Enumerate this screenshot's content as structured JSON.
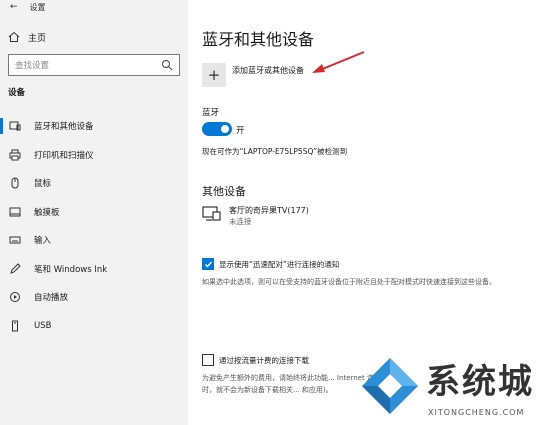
{
  "window": {
    "title": "设置"
  },
  "sidebar": {
    "home_label": "主页",
    "search_placeholder": "查找设置",
    "section_label": "设备",
    "items": [
      {
        "label": "蓝牙和其他设备",
        "icon": "bluetooth-icon",
        "active": true
      },
      {
        "label": "打印机和扫描仪",
        "icon": "printer-icon"
      },
      {
        "label": "鼠标",
        "icon": "mouse-icon"
      },
      {
        "label": "触摸板",
        "icon": "touchpad-icon"
      },
      {
        "label": "输入",
        "icon": "keyboard-icon"
      },
      {
        "label": "笔和 Windows Ink",
        "icon": "pen-icon"
      },
      {
        "label": "自动播放",
        "icon": "autoplay-icon"
      },
      {
        "label": "USB",
        "icon": "usb-icon"
      }
    ]
  },
  "main": {
    "title": "蓝牙和其他设备",
    "add_label": "添加蓝牙或其他设备",
    "bluetooth_label": "蓝牙",
    "toggle_state": "开",
    "discover_text": "现在可作为“LAPTOP-E75LP5SQ”被检测到",
    "other_devices_title": "其他设备",
    "device": {
      "name": "客厅的奇异果TV(177)",
      "status": "未连接"
    },
    "swift_pair_label": "显示使用“迅速配对”进行连接的通知",
    "swift_pair_desc": "如果选中此选项，则可以在受支持的蓝牙设备位于附近且处于配对模式时快速连接到这些设备。",
    "metered_label": "通过按流量计费的连接下载",
    "metered_desc": "为避免产生额外的费用，请始终将此功能... Internet 连接时，就不会为新设备下载相关... 和应用)。"
  },
  "watermark": {
    "text": "系统城",
    "url": "XITONGCHENG.COM"
  },
  "colors": {
    "accent": "#0078d7",
    "arrow": "#d9262f",
    "sidebar_bg": "#f2f2f2"
  }
}
